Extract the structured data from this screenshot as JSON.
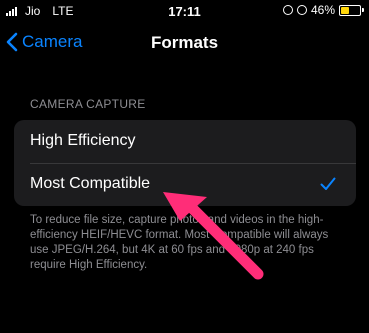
{
  "status_bar": {
    "carrier": "Jio",
    "network": "LTE",
    "time": "17:11",
    "battery_percent": "46%",
    "battery_fill": 0.46,
    "battery_color": "#ffd60a"
  },
  "nav": {
    "back_label": "Camera",
    "title": "Formats"
  },
  "section": {
    "header": "CAMERA CAPTURE",
    "options": [
      {
        "label": "High Efficiency",
        "selected": false
      },
      {
        "label": "Most Compatible",
        "selected": true
      }
    ],
    "footer": "To reduce file size, capture photos and videos in the high-efficiency HEIF/HEVC format. Most Compatible will always use JPEG/H.264, but 4K at 60 fps and 1080p at 240 fps require High Efficiency."
  },
  "colors": {
    "accent": "#0a84ff",
    "annotation_arrow": "#ff2d78"
  },
  "icons": {
    "back": "chevron-left-icon",
    "check": "checkmark-icon",
    "lock": "orientation-lock-icon",
    "alarm": "alarm-icon"
  }
}
